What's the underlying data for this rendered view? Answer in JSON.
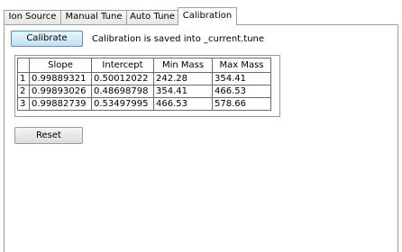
{
  "tabs": [
    {
      "label": "Ion Source"
    },
    {
      "label": "Manual Tune"
    },
    {
      "label": "Auto Tune"
    },
    {
      "label": "Calibration"
    }
  ],
  "calibrate_button_label": "Calibrate",
  "status_text": "Calibration is saved into _current.tune",
  "table": {
    "columns": [
      "",
      "Slope",
      "Intercept",
      "Min Mass",
      "Max Mass"
    ],
    "rows": [
      {
        "num": "1",
        "slope": "0.99889321",
        "intercept": "0.50012022",
        "min_mass": "242.28",
        "max_mass": "354.41"
      },
      {
        "num": "2",
        "slope": "0.99893026",
        "intercept": "0.48698798",
        "min_mass": "354.41",
        "max_mass": "466.53"
      },
      {
        "num": "3",
        "slope": "0.99882739",
        "intercept": "0.53497995",
        "min_mass": "466.53",
        "max_mass": "578.66"
      }
    ]
  },
  "reset_button_label": "Reset"
}
